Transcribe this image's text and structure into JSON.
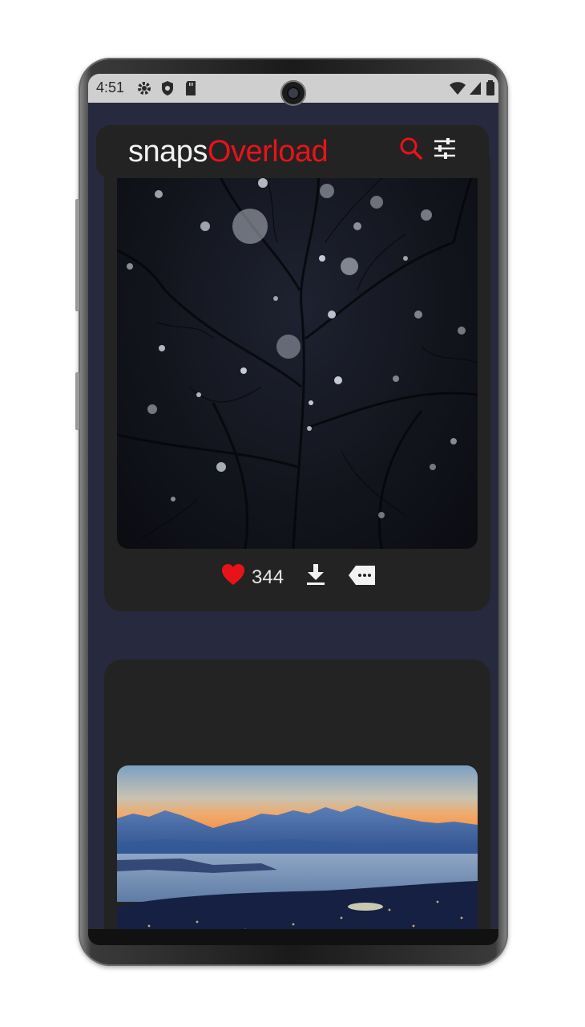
{
  "status_bar": {
    "time": "4:51",
    "left_icons": [
      "gear-icon",
      "shield-icon",
      "sd-card-icon"
    ],
    "right_icons": [
      "wifi-icon",
      "signal-icon",
      "battery-icon"
    ]
  },
  "header": {
    "brand_part1": "snaps",
    "brand_part2": "Overload",
    "accent_color": "#e8131a",
    "icons": [
      "search-icon",
      "filter-sliders-icon"
    ]
  },
  "feed": {
    "posts": [
      {
        "photo": "snowy-night-trees",
        "likes": "344",
        "actions": [
          "heart-icon",
          "download-icon",
          "more-tag-icon"
        ]
      },
      {
        "photo": "mountain-fjord-dusk"
      }
    ]
  },
  "colors": {
    "screen_bg": "#272a3e",
    "card_bg": "#232323",
    "like_red": "#e8131a"
  }
}
